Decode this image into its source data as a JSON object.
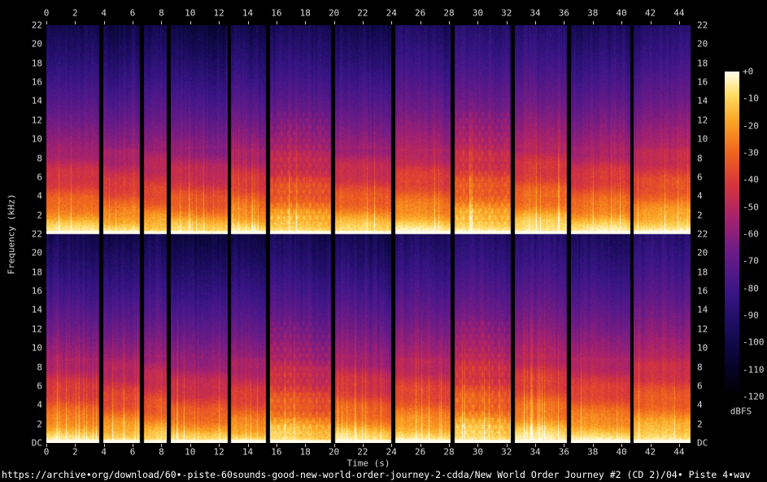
{
  "footer": {
    "url": "https://archive•org/download/60•-piste-60sounds-good-new-world-order-journey-2-cdda/New World Order Journey #2 (CD 2)/04• Piste 4•wav"
  },
  "chart_data": {
    "type": "heatmap",
    "subtype": "stereo-audio-spectrogram",
    "xlabel": "Time (s)",
    "ylabel": "Frequency (kHz)",
    "x_ticks": [
      0,
      2,
      4,
      6,
      8,
      10,
      12,
      14,
      16,
      18,
      20,
      22,
      24,
      26,
      28,
      30,
      32,
      34,
      36,
      38,
      40,
      42,
      44
    ],
    "x_range_s": [
      0,
      44.8
    ],
    "y_tick_labels": [
      "22",
      "20",
      "18",
      "16",
      "14",
      "12",
      "10",
      "8",
      "6",
      "4",
      "2"
    ],
    "y_dc_label": "DC",
    "y_range_khz": [
      0,
      22
    ],
    "channel_count": 2,
    "background_color": "#000000",
    "tick_text_color": "#d9d9d9",
    "footer_text_color": "#ffffff",
    "colorbar": {
      "label": "dBFS",
      "tick_labels": [
        "+0",
        "-10",
        "-20",
        "-30",
        "-40",
        "-50",
        "-60",
        "-70",
        "-80",
        "-90",
        "-100",
        "-110",
        "-120"
      ],
      "range_db": [
        -120,
        0
      ],
      "gradient_stops": [
        {
          "pos": 0.0,
          "color": "#000000"
        },
        {
          "pos": 0.1,
          "color": "#08042c"
        },
        {
          "pos": 0.2,
          "color": "#180c5a"
        },
        {
          "pos": 0.32,
          "color": "#3a1687"
        },
        {
          "pos": 0.45,
          "color": "#6e1c87"
        },
        {
          "pos": 0.55,
          "color": "#a8226e"
        },
        {
          "pos": 0.65,
          "color": "#d6343e"
        },
        {
          "pos": 0.75,
          "color": "#f0641e"
        },
        {
          "pos": 0.85,
          "color": "#fca624"
        },
        {
          "pos": 0.93,
          "color": "#ffde64"
        },
        {
          "pos": 1.0,
          "color": "#fffceb"
        }
      ]
    },
    "silence_gap_times_s": [
      3.8,
      6.6,
      8.5,
      12.7,
      15.4,
      19.9,
      24.1,
      28.2,
      32.4,
      36.3,
      40.7
    ],
    "silence_gap_width_s": 0.28,
    "segments": {
      "count": 12,
      "loudness_offsets_db": [
        0,
        -1,
        1,
        -1,
        0,
        1,
        0,
        2,
        3,
        3,
        1,
        3
      ],
      "dotted_texture_segments": [
        5,
        8
      ]
    }
  }
}
